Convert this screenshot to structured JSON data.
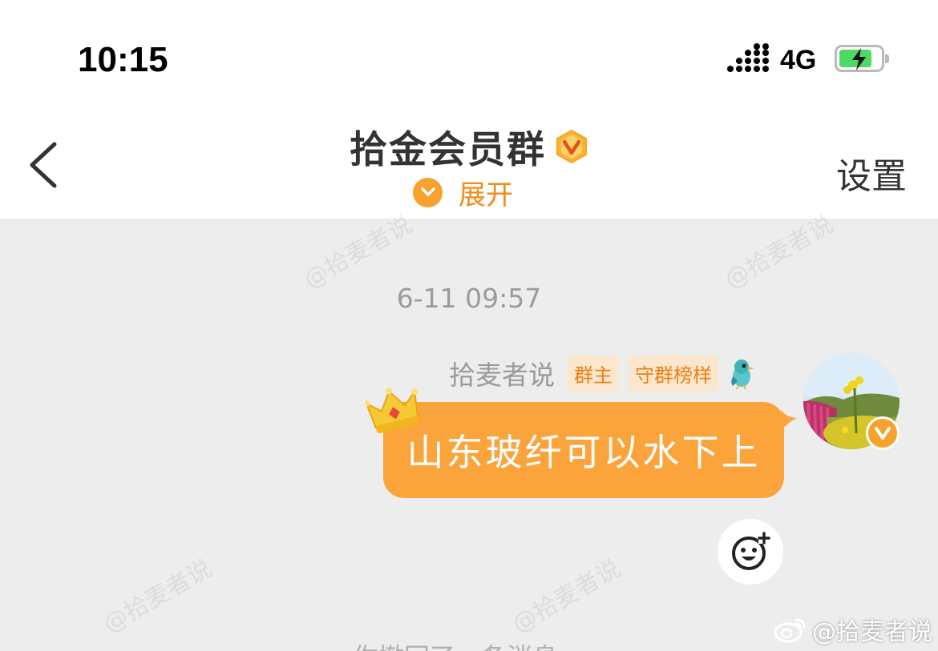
{
  "status": {
    "time": "10:15",
    "network": "4G"
  },
  "header": {
    "back_icon": "chevron-left-icon",
    "title": "拾金会员群",
    "expand_label": "展开",
    "settings_label": "设置"
  },
  "chat": {
    "timestamp": "6-11 09:57",
    "message": {
      "sender": "拾麦者说",
      "tags": [
        "群主",
        "守群榜样"
      ],
      "text": "山东玻纤可以水下上"
    },
    "bottom_hint": "你撤回了一条消息"
  },
  "watermark": {
    "text": "@拾麦者说",
    "credit": "@拾麦者说"
  },
  "colors": {
    "accent": "#f7a22c",
    "bubble": "#fba43c",
    "tag_bg": "#fbe7cd",
    "tag_text": "#f07e14",
    "background": "#ededed"
  }
}
